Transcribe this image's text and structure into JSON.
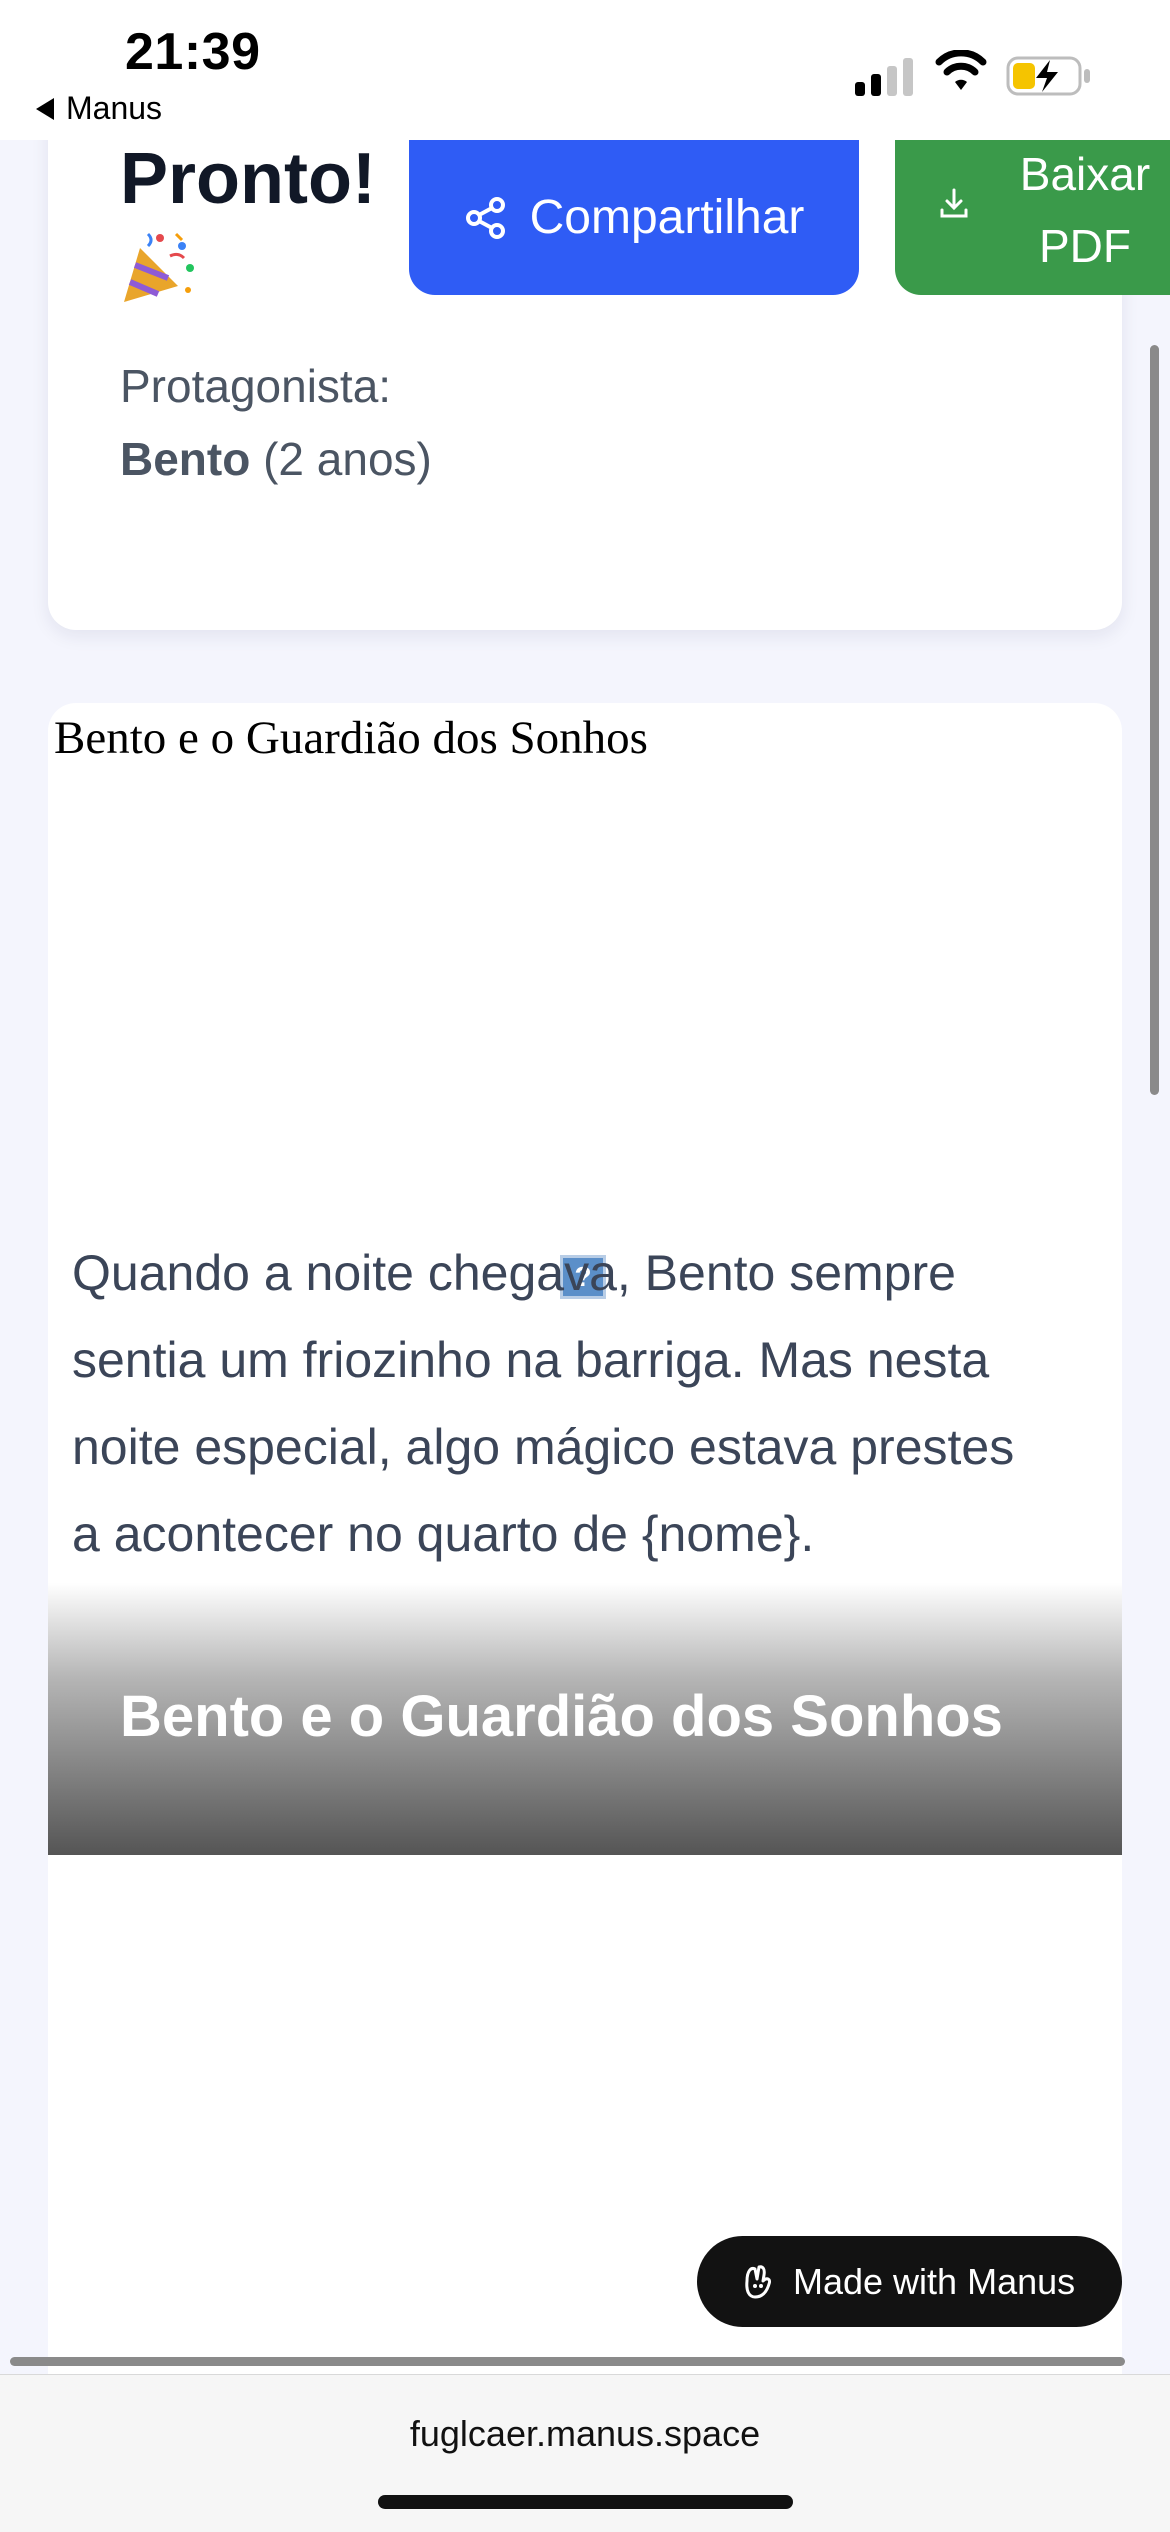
{
  "status_bar": {
    "time": "21:39",
    "back_app": "Manus",
    "icons": [
      "signal-icon",
      "wifi-icon",
      "battery-charging-icon"
    ]
  },
  "header": {
    "title": "Pronto!",
    "title_emoji": "party-popper-icon",
    "protagonist_label": "Protagonista:",
    "protagonist_name": "Bento",
    "protagonist_age": "(2 anos)"
  },
  "actions": {
    "share_label": "Compartilhar",
    "download_label": "Baixar PDF",
    "share_color": "#2f5cf5",
    "download_color": "#3a9a4a"
  },
  "story": {
    "image_alt": "Bento e o Guardião dos Sonhos",
    "title": "Bento e o Guardião dos Sonhos",
    "first_paragraph": "Quando a noite chegava, Bento sempre sentia um friozinho na barriga. Mas nesta noite especial, algo mágico estava prestes a acontecer no quarto de {nome}."
  },
  "badge": {
    "label": "Made with Manus"
  },
  "browser": {
    "url": "fuglcaer.manus.space"
  }
}
